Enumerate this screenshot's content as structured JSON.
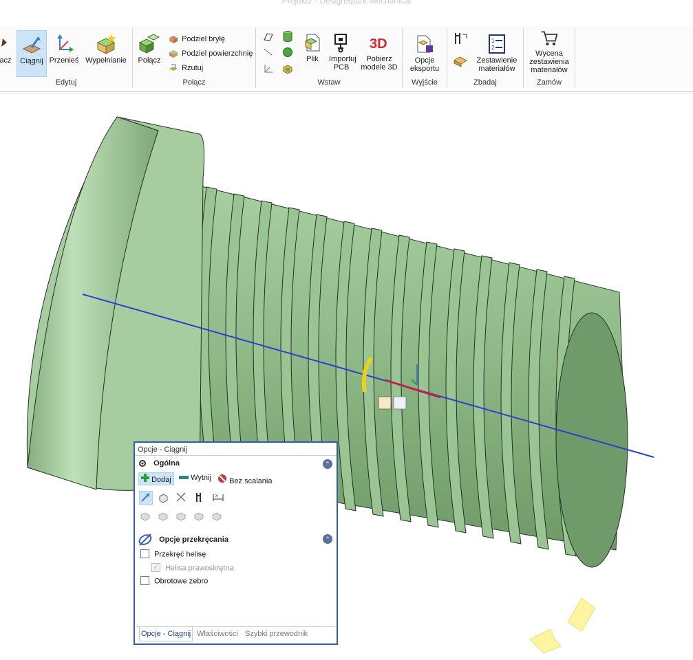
{
  "window": {
    "title": "Projekt2 - DesignSpark Mechanical"
  },
  "ribbon": {
    "edytuj": {
      "label": "Edytuj",
      "buttons": [
        {
          "label": "acz",
          "icon": "merge-icon"
        },
        {
          "label": "Ciągnij",
          "icon": "pull-icon",
          "active": true
        },
        {
          "label": "Przenieś",
          "icon": "move-icon"
        },
        {
          "label": "Wypełnianie",
          "icon": "fill-icon"
        }
      ]
    },
    "polacz": {
      "label": "Połącz",
      "big": {
        "label": "Połącz",
        "icon": "combine-icon"
      },
      "small": [
        {
          "label": "Podziel bryłę",
          "icon": "split-body-icon"
        },
        {
          "label": "Podziel powierzchnię",
          "icon": "split-surface-icon"
        },
        {
          "label": "Rzutuj",
          "icon": "project-icon"
        }
      ]
    },
    "wstaw": {
      "label": "Wstaw",
      "buttons": [
        {
          "label": "Plik",
          "icon": "file-icon"
        },
        {
          "label": "Importuj PCB",
          "icon": "pcb-icon"
        },
        {
          "label": "Pobierz modele 3D",
          "icon": "3d-models-icon"
        }
      ]
    },
    "wyjscie": {
      "label": "Wyjście",
      "buttons": [
        {
          "label": "Opcje eksportu",
          "icon": "export-icon"
        }
      ]
    },
    "zbadaj": {
      "label": "Zbadaj",
      "buttons": [
        {
          "label": "Zestawienie materiałów",
          "icon": "bom-icon"
        }
      ]
    },
    "zamow": {
      "label": "Zamów",
      "buttons": [
        {
          "label": "Wycena zestawienia materiałów",
          "icon": "cart-icon"
        }
      ]
    }
  },
  "panel": {
    "title": "Opcje - Ciągnij",
    "general": {
      "heading": "Ogólna",
      "modes": [
        {
          "label": "Dodaj",
          "icon": "add-icon",
          "active": true
        },
        {
          "label": "Wytnij",
          "icon": "cut-icon"
        },
        {
          "label": "Bez scalania",
          "icon": "no-merge-icon"
        }
      ]
    },
    "twist": {
      "heading": "Opcje przekręcania",
      "options": [
        {
          "label": "Przekręć helisę",
          "checked": false,
          "disabled": false
        },
        {
          "label": "Helisa prawoskrętna",
          "checked": true,
          "disabled": true
        },
        {
          "label": "Obrotowe żebro",
          "checked": false,
          "disabled": false
        }
      ]
    },
    "tabs": [
      "Opcje - Ciągnij",
      "Właściwości",
      "Szybki przewodnik"
    ]
  },
  "colors": {
    "model": "#8fb58a",
    "model_dark": "#5f8a5c",
    "axis": "#2a3fd0",
    "accent": "#2f5fa8",
    "selected_bg": "#cce4f7"
  }
}
